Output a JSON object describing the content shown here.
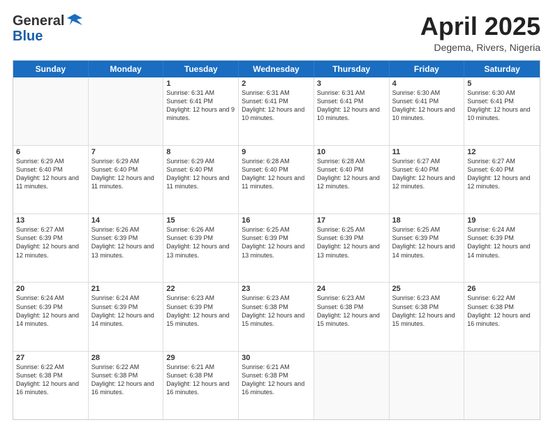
{
  "header": {
    "logo": {
      "general": "General",
      "blue": "Blue",
      "tagline": ""
    },
    "title": "April 2025",
    "subtitle": "Degema, Rivers, Nigeria"
  },
  "weekdays": [
    "Sunday",
    "Monday",
    "Tuesday",
    "Wednesday",
    "Thursday",
    "Friday",
    "Saturday"
  ],
  "rows": [
    [
      {
        "day": "",
        "text": ""
      },
      {
        "day": "",
        "text": ""
      },
      {
        "day": "1",
        "text": "Sunrise: 6:31 AM\nSunset: 6:41 PM\nDaylight: 12 hours and 9 minutes."
      },
      {
        "day": "2",
        "text": "Sunrise: 6:31 AM\nSunset: 6:41 PM\nDaylight: 12 hours and 10 minutes."
      },
      {
        "day": "3",
        "text": "Sunrise: 6:31 AM\nSunset: 6:41 PM\nDaylight: 12 hours and 10 minutes."
      },
      {
        "day": "4",
        "text": "Sunrise: 6:30 AM\nSunset: 6:41 PM\nDaylight: 12 hours and 10 minutes."
      },
      {
        "day": "5",
        "text": "Sunrise: 6:30 AM\nSunset: 6:41 PM\nDaylight: 12 hours and 10 minutes."
      }
    ],
    [
      {
        "day": "6",
        "text": "Sunrise: 6:29 AM\nSunset: 6:40 PM\nDaylight: 12 hours and 11 minutes."
      },
      {
        "day": "7",
        "text": "Sunrise: 6:29 AM\nSunset: 6:40 PM\nDaylight: 12 hours and 11 minutes."
      },
      {
        "day": "8",
        "text": "Sunrise: 6:29 AM\nSunset: 6:40 PM\nDaylight: 12 hours and 11 minutes."
      },
      {
        "day": "9",
        "text": "Sunrise: 6:28 AM\nSunset: 6:40 PM\nDaylight: 12 hours and 11 minutes."
      },
      {
        "day": "10",
        "text": "Sunrise: 6:28 AM\nSunset: 6:40 PM\nDaylight: 12 hours and 12 minutes."
      },
      {
        "day": "11",
        "text": "Sunrise: 6:27 AM\nSunset: 6:40 PM\nDaylight: 12 hours and 12 minutes."
      },
      {
        "day": "12",
        "text": "Sunrise: 6:27 AM\nSunset: 6:40 PM\nDaylight: 12 hours and 12 minutes."
      }
    ],
    [
      {
        "day": "13",
        "text": "Sunrise: 6:27 AM\nSunset: 6:39 PM\nDaylight: 12 hours and 12 minutes."
      },
      {
        "day": "14",
        "text": "Sunrise: 6:26 AM\nSunset: 6:39 PM\nDaylight: 12 hours and 13 minutes."
      },
      {
        "day": "15",
        "text": "Sunrise: 6:26 AM\nSunset: 6:39 PM\nDaylight: 12 hours and 13 minutes."
      },
      {
        "day": "16",
        "text": "Sunrise: 6:25 AM\nSunset: 6:39 PM\nDaylight: 12 hours and 13 minutes."
      },
      {
        "day": "17",
        "text": "Sunrise: 6:25 AM\nSunset: 6:39 PM\nDaylight: 12 hours and 13 minutes."
      },
      {
        "day": "18",
        "text": "Sunrise: 6:25 AM\nSunset: 6:39 PM\nDaylight: 12 hours and 14 minutes."
      },
      {
        "day": "19",
        "text": "Sunrise: 6:24 AM\nSunset: 6:39 PM\nDaylight: 12 hours and 14 minutes."
      }
    ],
    [
      {
        "day": "20",
        "text": "Sunrise: 6:24 AM\nSunset: 6:39 PM\nDaylight: 12 hours and 14 minutes."
      },
      {
        "day": "21",
        "text": "Sunrise: 6:24 AM\nSunset: 6:39 PM\nDaylight: 12 hours and 14 minutes."
      },
      {
        "day": "22",
        "text": "Sunrise: 6:23 AM\nSunset: 6:39 PM\nDaylight: 12 hours and 15 minutes."
      },
      {
        "day": "23",
        "text": "Sunrise: 6:23 AM\nSunset: 6:38 PM\nDaylight: 12 hours and 15 minutes."
      },
      {
        "day": "24",
        "text": "Sunrise: 6:23 AM\nSunset: 6:38 PM\nDaylight: 12 hours and 15 minutes."
      },
      {
        "day": "25",
        "text": "Sunrise: 6:23 AM\nSunset: 6:38 PM\nDaylight: 12 hours and 15 minutes."
      },
      {
        "day": "26",
        "text": "Sunrise: 6:22 AM\nSunset: 6:38 PM\nDaylight: 12 hours and 16 minutes."
      }
    ],
    [
      {
        "day": "27",
        "text": "Sunrise: 6:22 AM\nSunset: 6:38 PM\nDaylight: 12 hours and 16 minutes."
      },
      {
        "day": "28",
        "text": "Sunrise: 6:22 AM\nSunset: 6:38 PM\nDaylight: 12 hours and 16 minutes."
      },
      {
        "day": "29",
        "text": "Sunrise: 6:21 AM\nSunset: 6:38 PM\nDaylight: 12 hours and 16 minutes."
      },
      {
        "day": "30",
        "text": "Sunrise: 6:21 AM\nSunset: 6:38 PM\nDaylight: 12 hours and 16 minutes."
      },
      {
        "day": "",
        "text": ""
      },
      {
        "day": "",
        "text": ""
      },
      {
        "day": "",
        "text": ""
      }
    ]
  ]
}
